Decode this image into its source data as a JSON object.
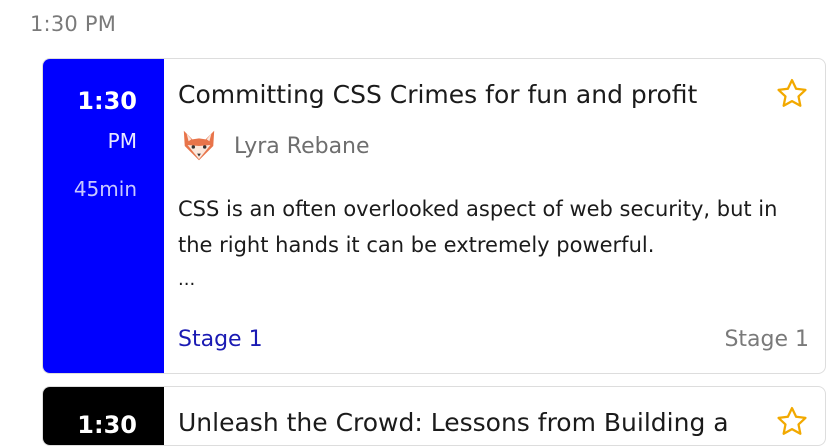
{
  "header": {
    "time": "1:30 PM"
  },
  "sessions": [
    {
      "time": "1:30",
      "ampm": "PM",
      "duration": "45min",
      "title": "Committing CSS Crimes for fun and profit",
      "speaker": "Lyra Rebane",
      "avatar_icon": "fox-icon",
      "description": "CSS is an often overlooked aspect of web security, but in the right hands it can be extremely powerful.",
      "ellipsis": "...",
      "stage_link": "Stage 1",
      "stage_label": "Stage 1",
      "starred": false,
      "accent": "#0000ff"
    },
    {
      "time": "1:30",
      "title": "Unleash the Crowd: Lessons from Building a",
      "accent": "#000000"
    }
  ],
  "colors": {
    "star": "#f2a900",
    "link": "#1a1ab3",
    "muted": "#7a7a7a"
  }
}
